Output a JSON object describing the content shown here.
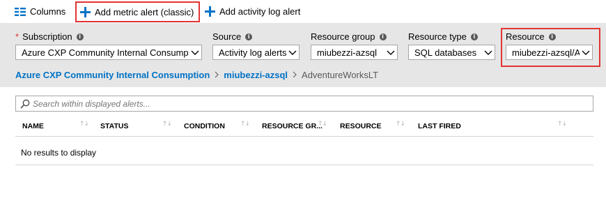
{
  "toolbar": {
    "columns_label": "Columns",
    "add_metric_label": "Add metric alert (classic)",
    "add_activity_label": "Add activity log alert"
  },
  "filters": {
    "subscription": {
      "label": "Subscription",
      "required_mark": "*",
      "value": "Azure CXP Community Internal Consumption"
    },
    "source": {
      "label": "Source",
      "value": "Activity log alerts"
    },
    "resource_group": {
      "label": "Resource group",
      "value": "miubezzi-azsql"
    },
    "resource_type": {
      "label": "Resource type",
      "value": "SQL databases"
    },
    "resource": {
      "label": "Resource",
      "value": "miubezzi-azsql/AdventureWorksLT"
    }
  },
  "breadcrumb": {
    "items": [
      "Azure CXP Community Internal Consumption",
      "miubezzi-azsql"
    ],
    "current": "AdventureWorksLT"
  },
  "search": {
    "placeholder": "Search within displayed alerts..."
  },
  "table": {
    "columns": [
      "NAME",
      "STATUS",
      "CONDITION",
      "RESOURCE GR...",
      "RESOURCE",
      "LAST FIRED"
    ],
    "empty_text": "No results to display"
  },
  "colors": {
    "accent": "#0072c6",
    "highlight": "#e23434",
    "filter_band": "#e6e6e6"
  },
  "icons": {
    "columns": "columns-icon",
    "add": "plus-icon",
    "info": "info-icon",
    "chevron": "chevron-down-icon",
    "search": "search-icon",
    "sort": "sort-icon"
  }
}
